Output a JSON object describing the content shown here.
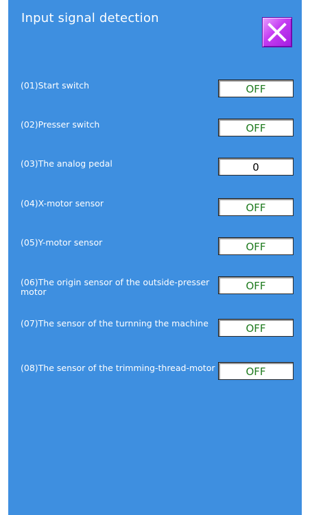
{
  "header": {
    "title": "Input signal detection"
  },
  "close_button": {
    "icon": "close-icon"
  },
  "signals": [
    {
      "label": "(01)Start switch",
      "value": "OFF"
    },
    {
      "label": "(02)Presser switch",
      "value": "OFF"
    },
    {
      "label": "(03)The analog pedal",
      "value": "0"
    },
    {
      "label": "(04)X-motor sensor",
      "value": "OFF"
    },
    {
      "label": "(05)Y-motor sensor",
      "value": "OFF"
    },
    {
      "label": "(06)The origin sensor of the outside-presser motor",
      "value": "OFF"
    },
    {
      "label": "(07)The sensor of the turnning the machine",
      "value": "OFF"
    },
    {
      "label": "(08)The sensor of the trimming-thread-motor",
      "value": "OFF"
    }
  ],
  "colors": {
    "panel_bg": "#3e8fe0",
    "off_text": "#1e7a1e",
    "close_bg": "#c43cf2"
  }
}
